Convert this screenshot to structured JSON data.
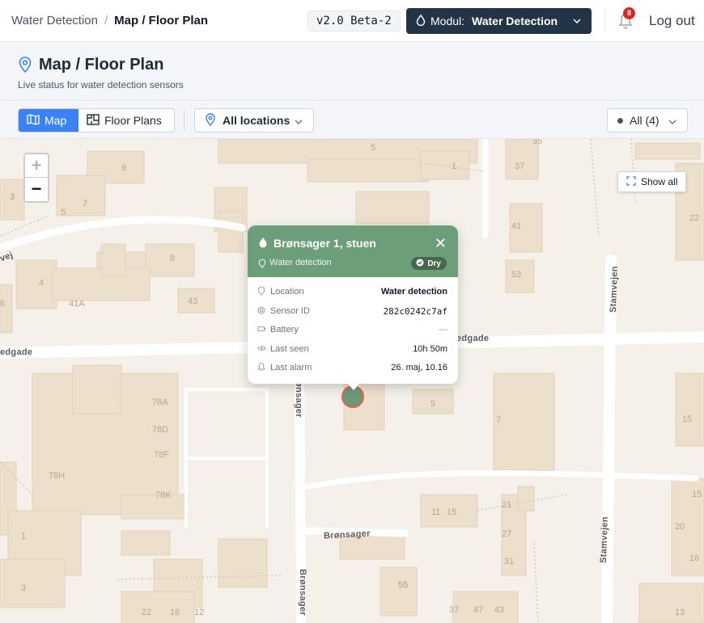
{
  "topbar": {
    "breadcrumb_root": "Water Detection",
    "breadcrumb_sep": "/",
    "breadcrumb_current": "Map / Floor Plan",
    "version": "v2.0 Beta-2",
    "modul_label": "Modul:",
    "modul_value": "Water Detection",
    "notification_count": "8",
    "logout": "Log out"
  },
  "header": {
    "title": "Map / Floor Plan",
    "subtitle": "Live status for water detection sensors"
  },
  "toolbar": {
    "view_map": "Map",
    "view_floorplans": "Floor Plans",
    "locations": "All locations",
    "filter": "All (4)"
  },
  "map": {
    "show_all": "Show all",
    "zoom_in": "+",
    "zoom_out": "−",
    "streets": [
      "edgade",
      "edgade",
      "Brønsager",
      "Brønsager",
      "Stamvejen",
      "Stamvejen",
      "vej",
      "Brønsager"
    ],
    "house_numbers": [
      "9",
      "5",
      "3",
      "1",
      "35",
      "37",
      "41",
      "53",
      "22",
      "5",
      "7",
      "3",
      "8",
      "4",
      "41A",
      "43",
      "6",
      "78A",
      "78D",
      "78F",
      "78H",
      "78K",
      "5",
      "7",
      "15",
      "15",
      "11",
      "15",
      "21",
      "27",
      "31",
      "20",
      "16",
      "1",
      "3",
      "55",
      "22",
      "16",
      "12",
      "47",
      "43",
      "37",
      "13",
      "55"
    ]
  },
  "popup": {
    "title": "Brønsager 1, stuen",
    "type": "Water detection",
    "status": "Dry",
    "close": "✕",
    "rows": [
      {
        "label": "Location",
        "value": "Water detection"
      },
      {
        "label": "Sensor ID",
        "value": "282c0242c7af"
      },
      {
        "label": "Battery",
        "value": "—"
      },
      {
        "label": "Last seen",
        "value": "10h 50m"
      },
      {
        "label": "Last alarm",
        "value": "26. maj, 10.16"
      }
    ]
  },
  "colors": {
    "accent": "#3b82f6",
    "modul_bg": "#243447",
    "popup_header": "#6d9e7a",
    "badge": "#dc2626",
    "marker_fill": "#6a9a7a",
    "marker_ring": "#e2653e"
  },
  "icons": {
    "header": "map-pin-icon",
    "modul": "water-drop-icon",
    "bell": "bell-icon",
    "map": "map-icon",
    "floorplan": "floorplan-icon",
    "locations": "map-pin-icon",
    "expand": "expand-icon",
    "check": "check-circle-icon"
  }
}
